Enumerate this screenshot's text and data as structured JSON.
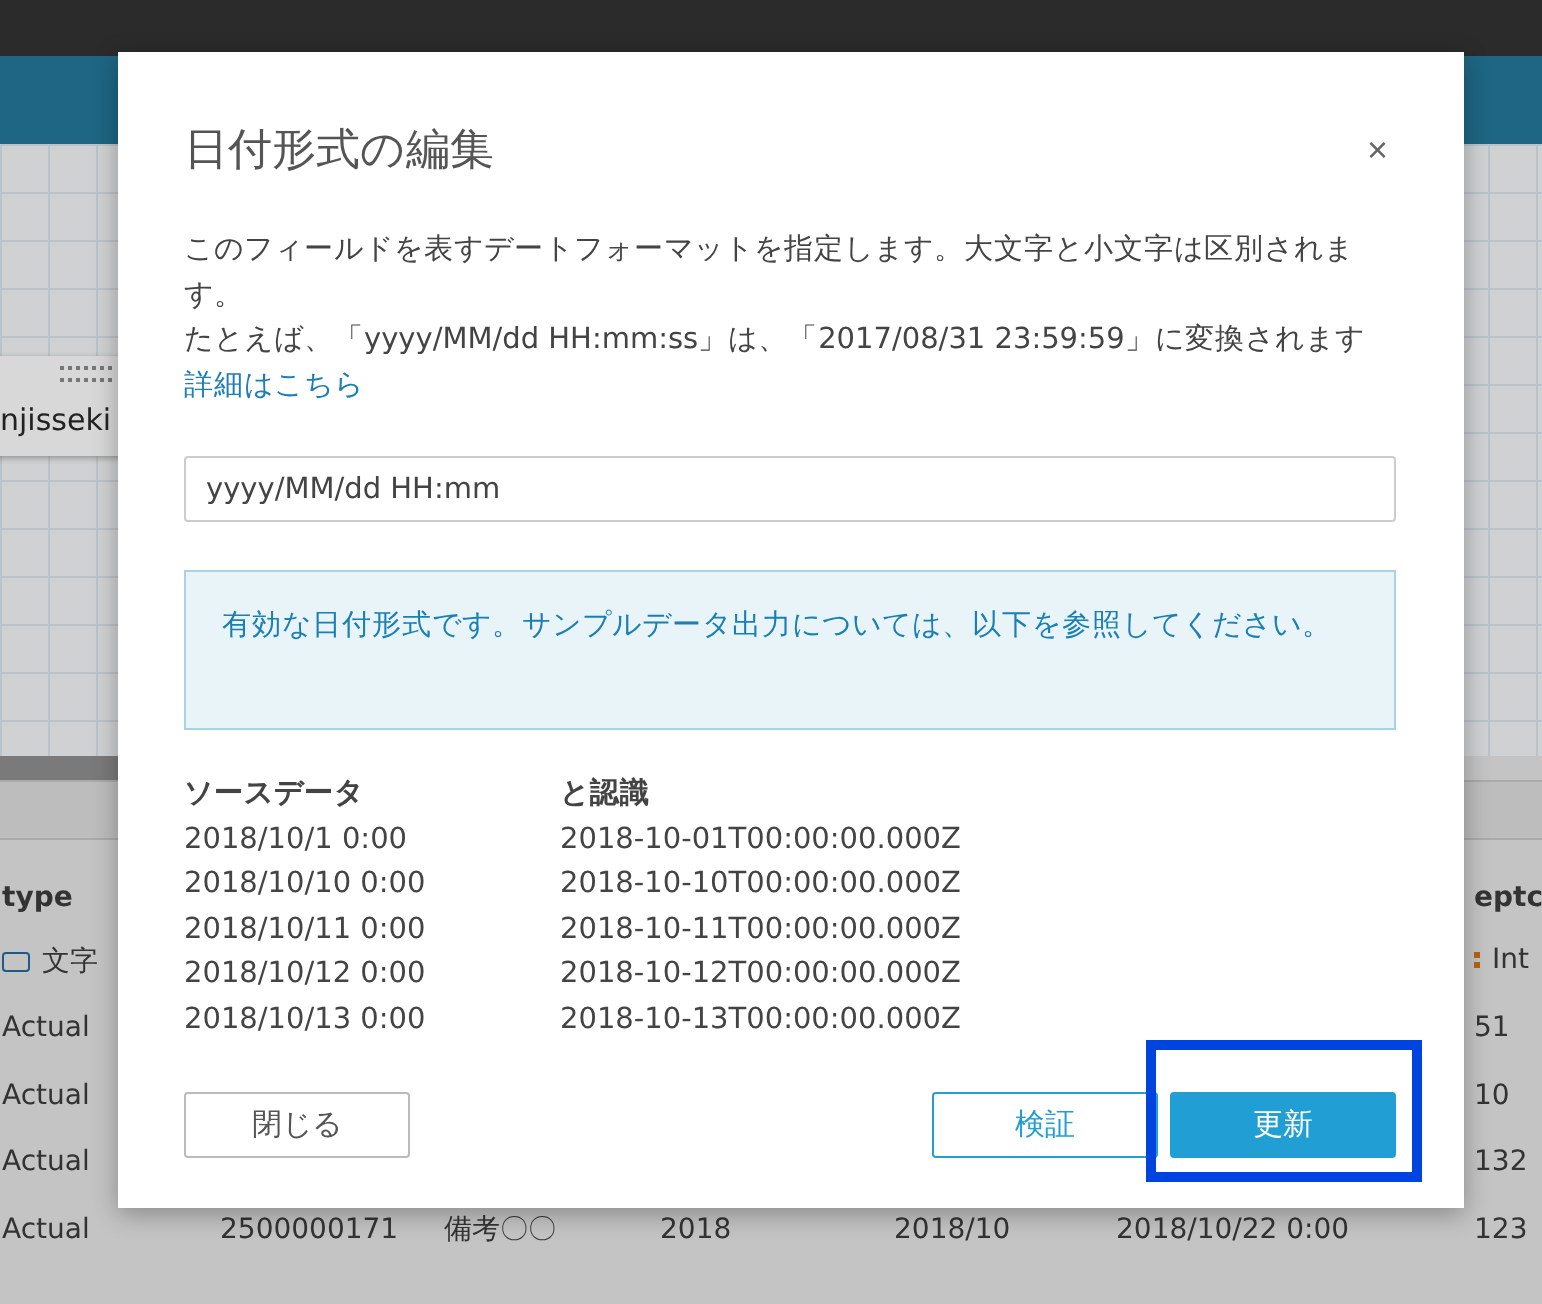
{
  "canvas": {
    "node_label": "njisseki"
  },
  "table": {
    "headers": {
      "type": "type",
      "column_7": "eptc"
    },
    "types": {
      "type": "文字",
      "column_7": "Int"
    },
    "rows": [
      {
        "type": "Actual",
        "column_7": "51"
      },
      {
        "type": "Actual",
        "column_7": "10"
      },
      {
        "type": "Actual",
        "column_7": "132"
      },
      {
        "type": "Actual",
        "column_2": "2500000171",
        "column_3": "備考〇〇",
        "column_4": "2018",
        "column_5": "2018/10",
        "column_6": "2018/10/22 0:00",
        "column_7": "123"
      }
    ]
  },
  "dialog": {
    "title": "日付形式の編集",
    "close": "×",
    "description": [
      "このフィールドを表すデートフォーマットを指定します。大文字と小文字は区別されます。",
      "たとえば、「yyyy/MM/dd HH:mm:ss」は、「2017/08/31 23:59:59」に変換されます"
    ],
    "link": "詳細はこちら",
    "format_field": {
      "value": "yyyy/MM/dd HH:mm"
    },
    "message": "有効な日付形式です。サンプルデータ出力については、以下を参照してください。",
    "sample": {
      "columns": [
        "ソースデータ",
        "と認識"
      ],
      "rows": [
        [
          "2018/10/1 0:00",
          "2018-10-01T00:00:00.000Z"
        ],
        [
          "2018/10/10 0:00",
          "2018-10-10T00:00:00.000Z"
        ],
        [
          "2018/10/11 0:00",
          "2018-10-11T00:00:00.000Z"
        ],
        [
          "2018/10/12 0:00",
          "2018-10-12T00:00:00.000Z"
        ],
        [
          "2018/10/13 0:00",
          "2018-10-13T00:00:00.000Z"
        ]
      ]
    },
    "buttons": [
      {
        "label": "閉じる",
        "kind": "default",
        "highlighted": false
      },
      {
        "label": "検証",
        "kind": "outline",
        "highlighted": false
      },
      {
        "label": "更新",
        "kind": "primary",
        "highlighted": true
      }
    ]
  }
}
